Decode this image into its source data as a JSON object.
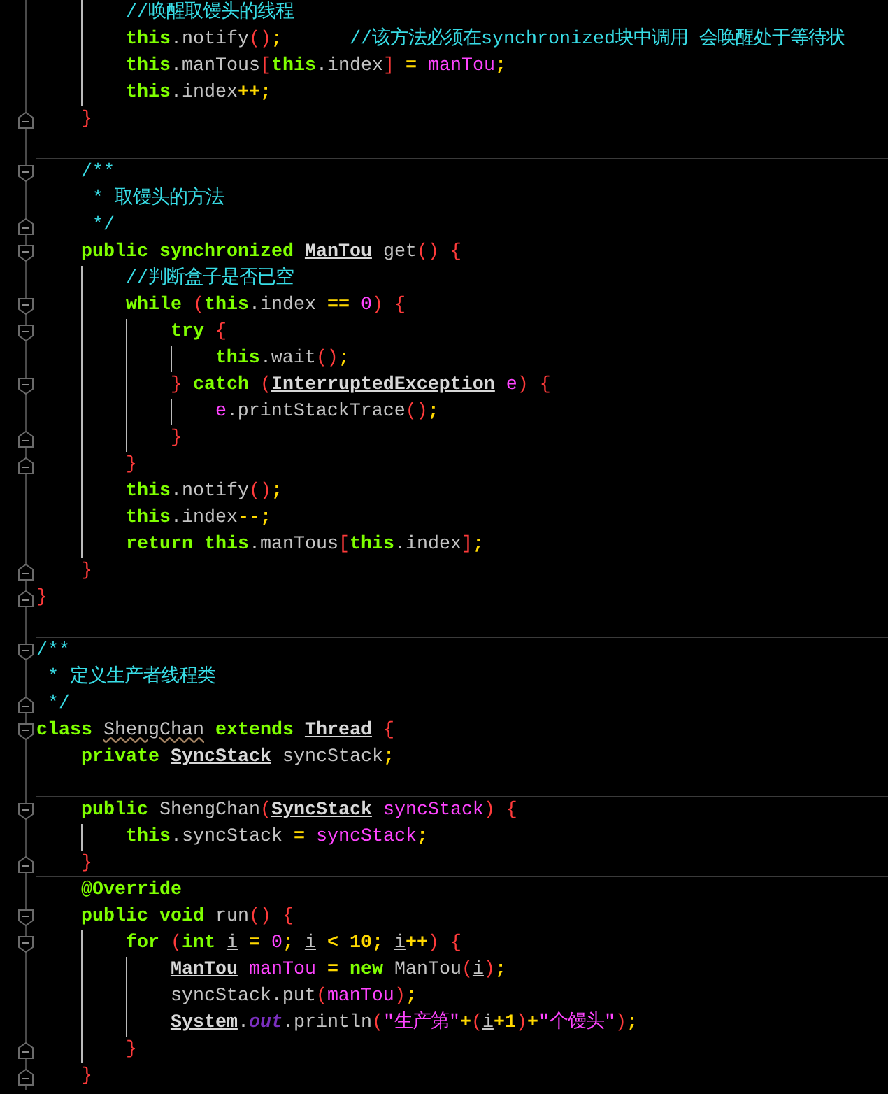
{
  "lines": [
    {
      "tokens": [
        {
          "kind": "comment",
          "text": "        //唤醒取馒头的线程"
        }
      ]
    },
    {
      "tokens": [
        {
          "kind": "keyword",
          "text": "        this"
        },
        {
          "kind": "plain",
          "text": ".notify"
        },
        {
          "kind": "bracket",
          "text": "()"
        },
        {
          "kind": "operator",
          "text": ";      "
        },
        {
          "kind": "comment",
          "text": "//该方法必须在synchronized块中调用 会唤醒处于等待状"
        }
      ]
    },
    {
      "tokens": [
        {
          "kind": "keyword",
          "text": "        this"
        },
        {
          "kind": "plain",
          "text": ".manTous"
        },
        {
          "kind": "bracket",
          "text": "["
        },
        {
          "kind": "keyword",
          "text": "this"
        },
        {
          "kind": "plain",
          "text": ".index"
        },
        {
          "kind": "bracket",
          "text": "] "
        },
        {
          "kind": "operator",
          "text": "= "
        },
        {
          "kind": "value",
          "text": "manTou"
        },
        {
          "kind": "operator",
          "text": ";"
        }
      ]
    },
    {
      "tokens": [
        {
          "kind": "keyword",
          "text": "        this"
        },
        {
          "kind": "plain",
          "text": ".index"
        },
        {
          "kind": "operator",
          "text": "++;"
        }
      ]
    },
    {
      "tokens": [
        {
          "kind": "bracket",
          "text": "    }"
        }
      ],
      "fold_end": true
    },
    {
      "separator": true
    },
    {
      "tokens": [
        {
          "kind": "comment",
          "text": "    /**"
        }
      ],
      "fold_start": true
    },
    {
      "tokens": [
        {
          "kind": "comment",
          "text": "     * 取馒头的方法"
        }
      ]
    },
    {
      "tokens": [
        {
          "kind": "comment",
          "text": "     */"
        }
      ],
      "fold_end": true
    },
    {
      "tokens": [
        {
          "kind": "keyword",
          "text": "    public synchronized "
        },
        {
          "kind": "type",
          "text": "ManTou"
        },
        {
          "kind": "plain",
          "text": " get"
        },
        {
          "kind": "bracket",
          "text": "() {"
        }
      ],
      "fold_start": true
    },
    {
      "tokens": [
        {
          "kind": "comment",
          "text": "        //判断盒子是否已空"
        }
      ]
    },
    {
      "tokens": [
        {
          "kind": "keyword",
          "text": "        while "
        },
        {
          "kind": "bracket",
          "text": "("
        },
        {
          "kind": "keyword",
          "text": "this"
        },
        {
          "kind": "plain",
          "text": ".index "
        },
        {
          "kind": "operator",
          "text": "== "
        },
        {
          "kind": "value",
          "text": "0"
        },
        {
          "kind": "bracket",
          "text": ") {"
        }
      ],
      "fold_start": true
    },
    {
      "tokens": [
        {
          "kind": "keyword",
          "text": "            try "
        },
        {
          "kind": "bracket",
          "text": "{"
        }
      ],
      "fold_start": true
    },
    {
      "tokens": [
        {
          "kind": "keyword",
          "text": "                this"
        },
        {
          "kind": "plain",
          "text": ".wait"
        },
        {
          "kind": "bracket",
          "text": "()"
        },
        {
          "kind": "operator",
          "text": ";"
        }
      ]
    },
    {
      "tokens": [
        {
          "kind": "bracket",
          "text": "            } "
        },
        {
          "kind": "keyword",
          "text": "catch "
        },
        {
          "kind": "bracket",
          "text": "("
        },
        {
          "kind": "type",
          "text": "InterruptedException"
        },
        {
          "kind": "value",
          "text": " e"
        },
        {
          "kind": "bracket",
          "text": ") {"
        }
      ],
      "fold_start": true
    },
    {
      "tokens": [
        {
          "kind": "value",
          "text": "                e"
        },
        {
          "kind": "plain",
          "text": ".printStackTrace"
        },
        {
          "kind": "bracket",
          "text": "()"
        },
        {
          "kind": "operator",
          "text": ";"
        }
      ]
    },
    {
      "tokens": [
        {
          "kind": "bracket",
          "text": "            }"
        }
      ],
      "fold_end": true
    },
    {
      "tokens": [
        {
          "kind": "bracket",
          "text": "        }"
        }
      ],
      "fold_end": true
    },
    {
      "tokens": [
        {
          "kind": "keyword",
          "text": "        this"
        },
        {
          "kind": "plain",
          "text": ".notify"
        },
        {
          "kind": "bracket",
          "text": "()"
        },
        {
          "kind": "operator",
          "text": ";"
        }
      ]
    },
    {
      "tokens": [
        {
          "kind": "keyword",
          "text": "        this"
        },
        {
          "kind": "plain",
          "text": ".index"
        },
        {
          "kind": "operator",
          "text": "--;"
        }
      ]
    },
    {
      "tokens": [
        {
          "kind": "keyword",
          "text": "        return this"
        },
        {
          "kind": "plain",
          "text": ".manTous"
        },
        {
          "kind": "bracket",
          "text": "["
        },
        {
          "kind": "keyword",
          "text": "this"
        },
        {
          "kind": "plain",
          "text": ".index"
        },
        {
          "kind": "bracket",
          "text": "]"
        },
        {
          "kind": "operator",
          "text": ";"
        }
      ]
    },
    {
      "tokens": [
        {
          "kind": "bracket",
          "text": "    }"
        }
      ],
      "fold_end": true
    },
    {
      "tokens": [
        {
          "kind": "bracket",
          "text": "}"
        }
      ],
      "fold_end": true
    },
    {
      "separator": true
    },
    {
      "tokens": [
        {
          "kind": "comment",
          "text": "/**"
        }
      ],
      "fold_start": true
    },
    {
      "tokens": [
        {
          "kind": "comment",
          "text": " * 定义生产者线程类"
        }
      ]
    },
    {
      "tokens": [
        {
          "kind": "comment",
          "text": " */"
        }
      ],
      "fold_end": true
    },
    {
      "tokens": [
        {
          "kind": "keyword",
          "text": "class "
        },
        {
          "kind": "declaration",
          "text": "ShengChan"
        },
        {
          "kind": "keyword",
          "text": " extends "
        },
        {
          "kind": "type",
          "text": "Thread"
        },
        {
          "kind": "bracket",
          "text": " {"
        }
      ],
      "fold_start": true
    },
    {
      "tokens": [
        {
          "kind": "keyword",
          "text": "    private "
        },
        {
          "kind": "type",
          "text": "SyncStack"
        },
        {
          "kind": "plain",
          "text": " syncStack"
        },
        {
          "kind": "operator",
          "text": ";"
        }
      ]
    },
    {
      "separator": true
    },
    {
      "tokens": [
        {
          "kind": "keyword",
          "text": "    public"
        },
        {
          "kind": "plain",
          "text": " ShengChan"
        },
        {
          "kind": "bracket",
          "text": "("
        },
        {
          "kind": "type",
          "text": "SyncStack"
        },
        {
          "kind": "value",
          "text": " syncStack"
        },
        {
          "kind": "bracket",
          "text": ") {"
        }
      ],
      "fold_start": true
    },
    {
      "tokens": [
        {
          "kind": "keyword",
          "text": "        this"
        },
        {
          "kind": "plain",
          "text": ".syncStack "
        },
        {
          "kind": "operator",
          "text": "= "
        },
        {
          "kind": "value",
          "text": "syncStack"
        },
        {
          "kind": "operator",
          "text": ";"
        }
      ]
    },
    {
      "tokens": [
        {
          "kind": "bracket",
          "text": "    }"
        }
      ],
      "fold_end": true,
      "separator": true
    },
    {
      "tokens": [
        {
          "kind": "keyword",
          "text": "    @Override"
        }
      ]
    },
    {
      "tokens": [
        {
          "kind": "keyword",
          "text": "    public void"
        },
        {
          "kind": "plain",
          "text": " run"
        },
        {
          "kind": "bracket",
          "text": "() {"
        }
      ],
      "fold_start": true
    },
    {
      "tokens": [
        {
          "kind": "keyword",
          "text": "        for "
        },
        {
          "kind": "bracket",
          "text": "("
        },
        {
          "kind": "keyword",
          "text": "int "
        },
        {
          "kind": "usage",
          "text": "i"
        },
        {
          "kind": "operator",
          "text": " = "
        },
        {
          "kind": "value",
          "text": "0"
        },
        {
          "kind": "operator",
          "text": "; "
        },
        {
          "kind": "usage",
          "text": "i"
        },
        {
          "kind": "operator",
          "text": " < 10; "
        },
        {
          "kind": "usage",
          "text": "i"
        },
        {
          "kind": "operator",
          "text": "++"
        },
        {
          "kind": "bracket",
          "text": ") {"
        }
      ],
      "fold_start": true
    },
    {
      "tokens": [
        {
          "kind": "type",
          "text": "            ManTou"
        },
        {
          "kind": "value",
          "text": " manTou"
        },
        {
          "kind": "operator",
          "text": " = "
        },
        {
          "kind": "keyword",
          "text": "new"
        },
        {
          "kind": "plain",
          "text": " ManTou"
        },
        {
          "kind": "bracket",
          "text": "("
        },
        {
          "kind": "usage",
          "text": "i"
        },
        {
          "kind": "bracket",
          "text": ")"
        },
        {
          "kind": "operator",
          "text": ";"
        }
      ]
    },
    {
      "tokens": [
        {
          "kind": "plain",
          "text": "            syncStack.put"
        },
        {
          "kind": "bracket",
          "text": "("
        },
        {
          "kind": "value",
          "text": "manTou"
        },
        {
          "kind": "bracket",
          "text": ")"
        },
        {
          "kind": "operator",
          "text": ";"
        }
      ]
    },
    {
      "tokens": [
        {
          "kind": "type",
          "text": "            System"
        },
        {
          "kind": "plain",
          "text": "."
        },
        {
          "kind": "static",
          "text": "out"
        },
        {
          "kind": "plain",
          "text": ".println"
        },
        {
          "kind": "bracket",
          "text": "("
        },
        {
          "kind": "value",
          "text": "\"生产第\""
        },
        {
          "kind": "operator",
          "text": "+"
        },
        {
          "kind": "bracket",
          "text": "("
        },
        {
          "kind": "usage",
          "text": "i"
        },
        {
          "kind": "operator",
          "text": "+1"
        },
        {
          "kind": "bracket",
          "text": ")"
        },
        {
          "kind": "operator",
          "text": "+"
        },
        {
          "kind": "value",
          "text": "\"个馒头\""
        },
        {
          "kind": "bracket",
          "text": ")"
        },
        {
          "kind": "operator",
          "text": ";"
        }
      ]
    },
    {
      "tokens": [
        {
          "kind": "bracket",
          "text": "        }"
        }
      ],
      "fold_end": true
    },
    {
      "tokens": [
        {
          "kind": "bracket",
          "text": "    }"
        }
      ],
      "fold_end": true
    }
  ]
}
